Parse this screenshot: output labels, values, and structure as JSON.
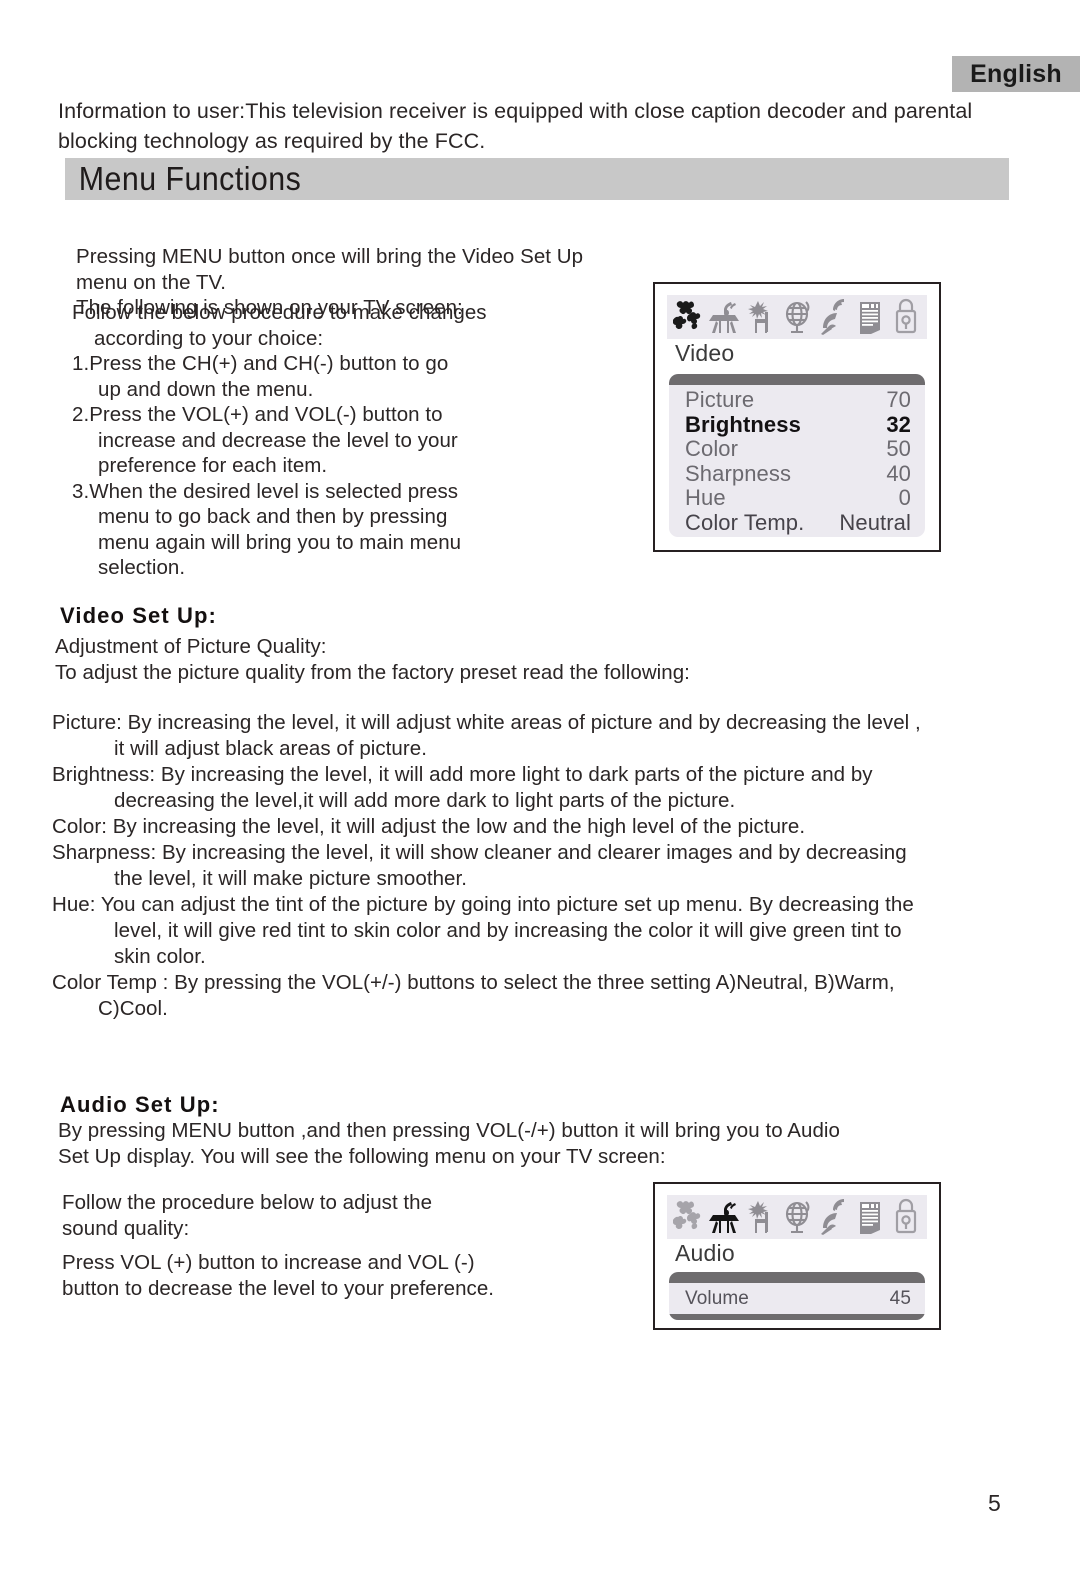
{
  "language_tab": {
    "label": "English"
  },
  "intro_notice": "Information to user:This television receiver is equipped with close caption decoder and parental blocking technology as required by the FCC.",
  "banner": {
    "title": "Menu   Functions"
  },
  "instructions": {
    "intro_line1": "Pressing MENU button once will bring the Video Set Up menu on the TV.",
    "intro_line2": "The following is shown on your TV screen:",
    "follow_line1": "Follow the below procedure to make changes",
    "follow_line2": "according to your choice:",
    "steps": [
      {
        "main": "1.Press the CH(+) and CH(-) button to go",
        "cont": [
          "up and down the menu."
        ]
      },
      {
        "main": "2.Press the VOL(+) and VOL(-) button to",
        "cont": [
          "increase and decrease the level to your",
          "preference for each item."
        ]
      },
      {
        "main": "3.When the desired level is selected press",
        "cont": [
          "menu to go back and then by pressing",
          "menu again will bring you to main menu",
          "selection."
        ]
      }
    ]
  },
  "osd_video": {
    "menu_label": "Video",
    "icons": [
      "picture-icon",
      "audio-icon",
      "setup-icon",
      "globe-icon",
      "satellite-icon",
      "channel-list-icon",
      "lock-icon"
    ],
    "selected_icon_index": 0,
    "rows": [
      {
        "label": "Picture",
        "value": "70",
        "selected": false
      },
      {
        "label": "Brightness",
        "value": "32",
        "selected": true
      },
      {
        "label": "Color",
        "value": "50",
        "selected": false
      },
      {
        "label": "Sharpness",
        "value": "40",
        "selected": false
      },
      {
        "label": "Hue",
        "value": "0",
        "selected": false
      },
      {
        "label": "Color Temp.",
        "value": "Neutral",
        "selected": false
      }
    ]
  },
  "osd_audio": {
    "menu_label": "Audio",
    "icons": [
      "picture-icon",
      "audio-icon",
      "setup-icon",
      "globe-icon",
      "satellite-icon",
      "channel-list-icon",
      "lock-icon"
    ],
    "selected_icon_index": 1,
    "rows": [
      {
        "label": "Volume",
        "value": "45",
        "selected": false
      }
    ]
  },
  "video_setup": {
    "heading": "Video Set Up:",
    "sub_line1": "Adjustment of Picture Quality:",
    "sub_line2": "To adjust the picture quality from the factory preset read the following:",
    "definitions": [
      {
        "main": "Picture: By increasing the level, it will adjust white areas of picture and by decreasing the level ,",
        "cont": [
          "it will adjust black areas of picture."
        ]
      },
      {
        "main": "Brightness: By increasing the level, it will add more light to dark parts of the picture and by",
        "cont": [
          "decreasing the level,it will add more dark to light parts of the picture."
        ]
      },
      {
        "main": "Color: By increasing the level, it will adjust the low  and the high level of  the picture.",
        "cont": []
      },
      {
        "main": "Sharpness: By increasing the level, it will show cleaner and clearer images and by decreasing",
        "cont": [
          "the level, it will make picture smoother."
        ]
      },
      {
        "main": "Hue: You can adjust the tint of the picture by going into picture set up menu. By decreasing the",
        "cont": [
          "level, it will give red tint to skin color and by increasing the color  it will give green tint to",
          "skin color."
        ]
      },
      {
        "main": "Color Temp : By pressing the VOL(+/-) buttons to select the three setting A)Neutral,  B)Warm,",
        "cont": [
          "C)Cool."
        ]
      }
    ]
  },
  "audio_setup": {
    "heading": "Audio Set Up:",
    "sub_line1": "By pressing MENU button ,and then pressing VOL(-/+) button it will bring you to Audio",
    "sub_line2": "Set Up display. You will see the following menu on your TV screen:",
    "left_line1": "Follow the procedure below to adjust  the",
    "left_line2": "sound quality:",
    "left_line3": "Press VOL (+) button to increase and VOL (-)",
    "left_line4": "button to decrease the level to your preference."
  },
  "page_number": "5"
}
